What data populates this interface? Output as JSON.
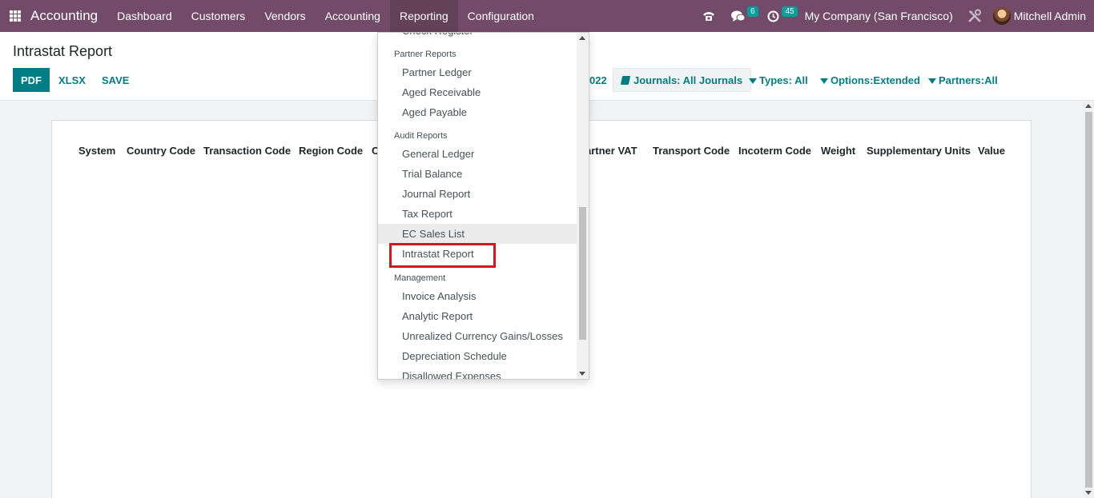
{
  "navbar": {
    "brand": "Accounting",
    "menu": [
      "Dashboard",
      "Customers",
      "Vendors",
      "Accounting",
      "Reporting",
      "Configuration"
    ],
    "active_menu": "Reporting",
    "chat_badge": "6",
    "activity_badge": "45",
    "company": "My Company (San Francisco)",
    "user": "Mitchell Admin"
  },
  "control_panel": {
    "title": "Intrastat Report",
    "buttons": {
      "pdf": "PDF",
      "xlsx": "XLSX",
      "save": "SAVE"
    },
    "date_filter_tail": "022",
    "filters": {
      "journals": "Journals: All Journals",
      "types": "Types: All",
      "options": "Options:Extended",
      "partners": "Partners:All"
    }
  },
  "report": {
    "headers": [
      "System",
      "Country Code",
      "Transaction Code",
      "Region Code",
      "C",
      "artner VAT",
      "Transport Code",
      "Incoterm Code",
      "Weight",
      "Supplementary Units",
      "Value"
    ]
  },
  "dropdown": {
    "cut_item": "Check Register",
    "sections": [
      {
        "title": "Partner Reports",
        "items": [
          "Partner Ledger",
          "Aged Receivable",
          "Aged Payable"
        ]
      },
      {
        "title": "Audit Reports",
        "items": [
          "General Ledger",
          "Trial Balance",
          "Journal Report",
          "Tax Report",
          "EC Sales List",
          "Intrastat Report"
        ]
      },
      {
        "title": "Management",
        "items": [
          "Invoice Analysis",
          "Analytic Report",
          "Unrealized Currency Gains/Losses",
          "Depreciation Schedule",
          "Disallowed Expenses"
        ]
      }
    ],
    "hovered_item": "EC Sales List",
    "highlighted_item": "Intrastat Report"
  },
  "colors": {
    "navbar": "#714B67",
    "primary": "#017E84",
    "badge": "#00A09D",
    "highlight": "#d9141a"
  }
}
